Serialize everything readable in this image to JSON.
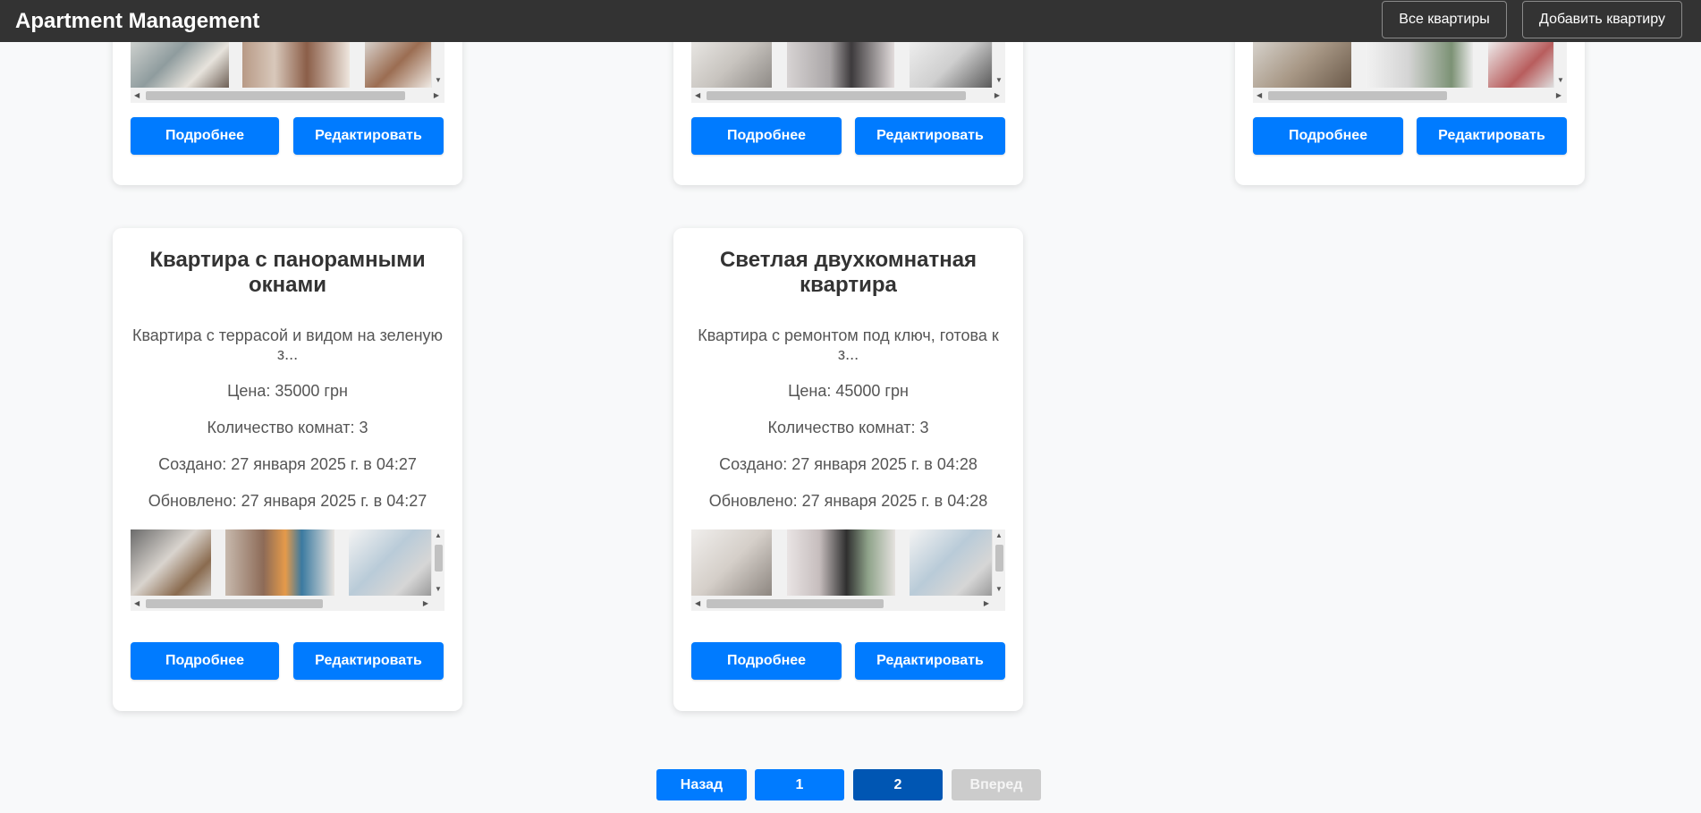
{
  "header": {
    "title": "Apartment Management",
    "all_label": "Все квартиры",
    "add_label": "Добавить квартиру"
  },
  "cards": [
    {
      "details": "Подробнее",
      "edit": "Редактировать"
    },
    {
      "details": "Подробнее",
      "edit": "Редактировать"
    },
    {
      "details": "Подробнее",
      "edit": "Редактировать"
    },
    {
      "title": "Квартира с панорамными окнами",
      "description": "Квартира с террасой и видом на зеленую з...",
      "price": "Цена: 35000 грн",
      "rooms": "Количество комнат: 3",
      "created": "Создано: 27 января 2025 г. в 04:27",
      "updated": "Обновлено: 27 января 2025 г. в 04:27",
      "details": "Подробнее",
      "edit": "Редактировать"
    },
    {
      "title": "Светлая двухкомнатная квартира",
      "description": "Квартира с ремонтом под ключ, готова к з...",
      "price": "Цена: 45000 грн",
      "rooms": "Количество комнат: 3",
      "created": "Создано: 27 января 2025 г. в 04:28",
      "updated": "Обновлено: 27 января 2025 г. в 04:28",
      "details": "Подробнее",
      "edit": "Редактировать"
    }
  ],
  "pagination": {
    "prev": "Назад",
    "page1": "1",
    "page2": "2",
    "next": "Вперед",
    "current_page": 2
  },
  "colors": {
    "primary": "#007bff",
    "active_page": "#0056b3",
    "disabled": "#cccccc",
    "header_bg": "#333333"
  }
}
